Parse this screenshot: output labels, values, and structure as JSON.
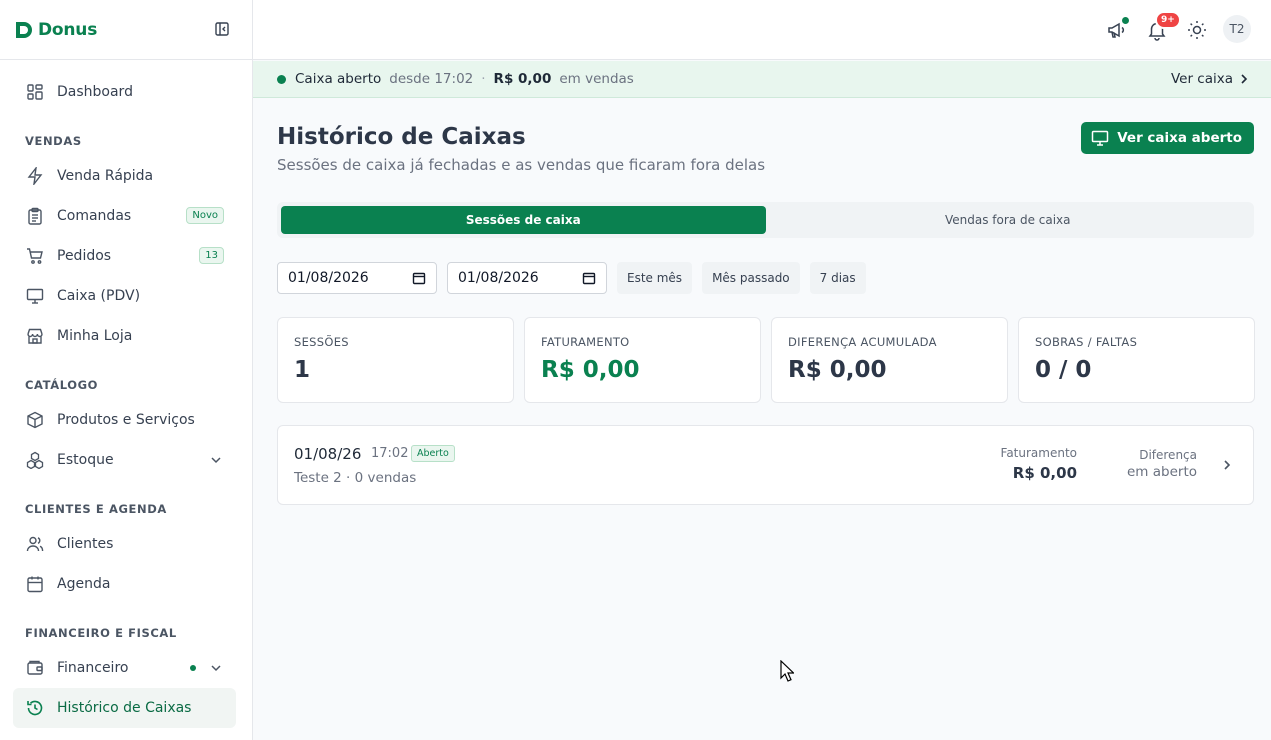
{
  "brand": {
    "name": "Donus"
  },
  "sidebar": {
    "items_top": [
      {
        "label": "Dashboard",
        "icon": "grid-icon"
      }
    ],
    "sections": [
      {
        "title": "VENDAS",
        "items": [
          {
            "label": "Venda Rápida",
            "icon": "lightning-icon"
          },
          {
            "label": "Comandas",
            "icon": "clipboard-icon",
            "badge": "Novo"
          },
          {
            "label": "Pedidos",
            "icon": "cart-icon",
            "badge": "13"
          },
          {
            "label": "Caixa (PDV)",
            "icon": "monitor-icon"
          },
          {
            "label": "Minha Loja",
            "icon": "store-icon"
          }
        ]
      },
      {
        "title": "CATÁLOGO",
        "items": [
          {
            "label": "Produtos e Serviços",
            "icon": "box-icon"
          },
          {
            "label": "Estoque",
            "icon": "boxes-icon"
          }
        ]
      },
      {
        "title": "CLIENTES E AGENDA",
        "items": [
          {
            "label": "Clientes",
            "icon": "users-icon"
          },
          {
            "label": "Agenda",
            "icon": "calendar-icon"
          }
        ]
      },
      {
        "title": "FINANCEIRO E FISCAL",
        "items": [
          {
            "label": "Financeiro",
            "icon": "wallet-icon"
          },
          {
            "label": "Histórico de Caixas",
            "icon": "history-icon",
            "active": true
          }
        ]
      }
    ]
  },
  "topbar": {
    "notif_badge": "9+",
    "avatar": "T2"
  },
  "banner": {
    "status": "Caixa aberto",
    "since": "desde 17:02",
    "sep": "·",
    "amount": "R$ 0,00",
    "sales": "em vendas",
    "link": "Ver caixa"
  },
  "page": {
    "title": "Histórico de Caixas",
    "subtitle": "Sessões de caixa já fechadas e as vendas que ficaram fora delas",
    "primary_button": "Ver caixa aberto"
  },
  "tabs": [
    {
      "label": "Sessões de caixa",
      "active": true
    },
    {
      "label": "Vendas fora de caixa",
      "active": false
    }
  ],
  "filters": {
    "date_from": "01/08/2026",
    "date_to": "01/08/2026",
    "chips": [
      "Este mês",
      "Mês passado",
      "7 dias"
    ]
  },
  "stats": [
    {
      "label": "SESSÕES",
      "value": "1"
    },
    {
      "label": "FATURAMENTO",
      "value": "R$ 0,00"
    },
    {
      "label": "DIFERENÇA ACUMULADA",
      "value": "R$ 0,00"
    },
    {
      "label": "SOBRAS / FALTAS",
      "value": "0 / 0"
    }
  ],
  "session": {
    "date": "01/08/26",
    "time": "17:02",
    "badge": "Aberto",
    "sub": "Teste 2 · 0 vendas",
    "fat_label": "Faturamento",
    "fat_value": "R$ 0,00",
    "dif_label": "Diferença",
    "dif_value": "em aberto"
  },
  "colors": {
    "brand": "#0a8150",
    "alert": "#ef4444"
  }
}
